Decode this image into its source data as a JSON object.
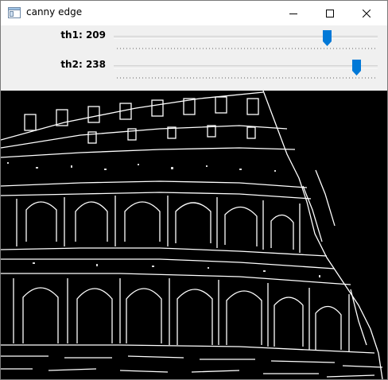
{
  "window": {
    "title": "canny edge",
    "icons": {
      "app": "window-app-icon",
      "minimize": "minimize-icon",
      "maximize": "maximize-icon",
      "close": "close-icon"
    }
  },
  "trackbars": [
    {
      "name": "th1",
      "value": "209",
      "value_num": 209,
      "max": 255
    },
    {
      "name": "th2",
      "value": "238",
      "value_num": 238,
      "max": 255
    }
  ],
  "colors": {
    "thumb": "#0078d7",
    "canvas_bg": "#000000",
    "edges": "#ffffff"
  }
}
